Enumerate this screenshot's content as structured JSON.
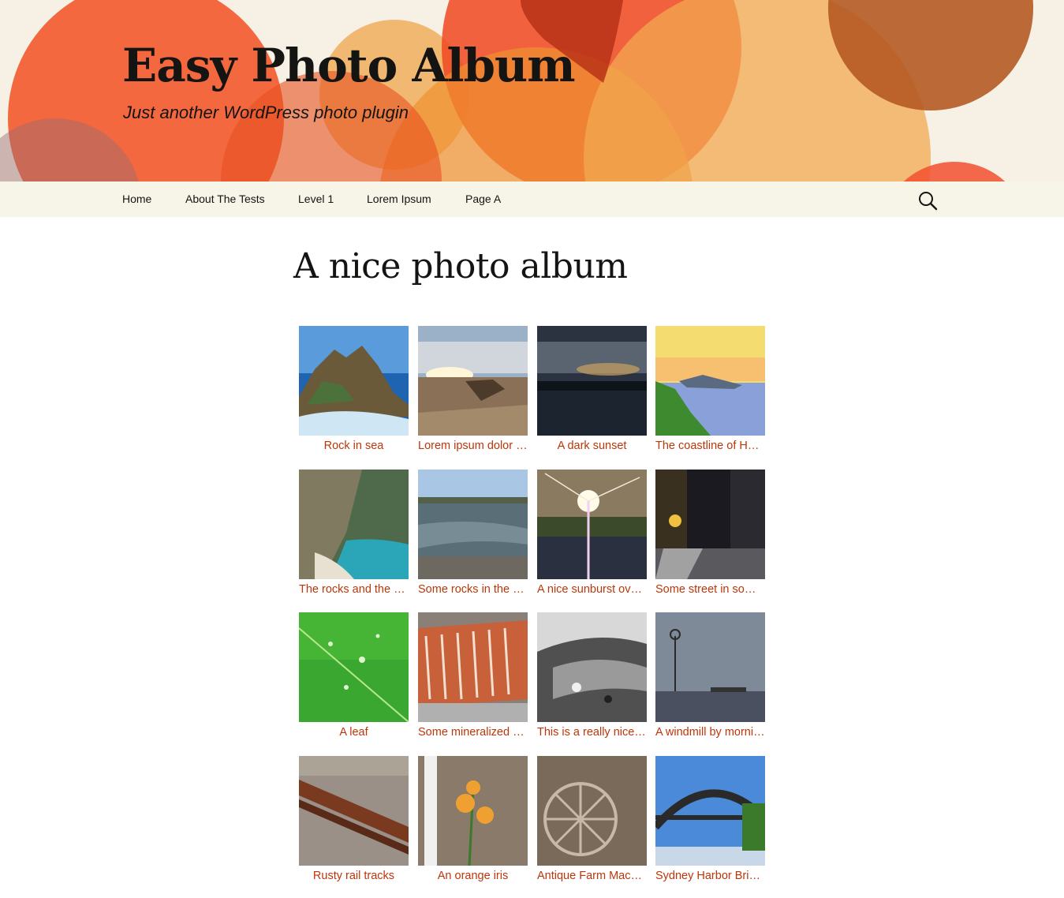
{
  "site": {
    "title": "Easy Photo Album",
    "description": "Just another WordPress photo plugin"
  },
  "nav": {
    "items": [
      "Home",
      "About The Tests",
      "Level 1",
      "Lorem Ipsum",
      "Page A"
    ],
    "search_icon": "search-icon"
  },
  "page": {
    "title": "A nice photo album"
  },
  "colors": {
    "link": "#bc360a",
    "header_bg": "#f6f1e4",
    "nav_bg": "#f7f5e7"
  },
  "gallery": {
    "photos": [
      {
        "caption": "Rock in sea"
      },
      {
        "caption": "Lorem ipsum dolor sit amet"
      },
      {
        "caption": "A dark sunset"
      },
      {
        "caption": "The coastline of Hawaii"
      },
      {
        "caption": "The rocks and the sea"
      },
      {
        "caption": "Some rocks in the sea"
      },
      {
        "caption": "A nice sunburst over the water"
      },
      {
        "caption": "Some street in some city"
      },
      {
        "caption": "A leaf"
      },
      {
        "caption": "Some mineralized wood"
      },
      {
        "caption": "This is a really nice photo"
      },
      {
        "caption": "A windmill by morning"
      },
      {
        "caption": "Rusty rail tracks"
      },
      {
        "caption": "An orange iris"
      },
      {
        "caption": "Antique Farm Machinery"
      },
      {
        "caption": "Sydney Harbor Bridge"
      }
    ]
  }
}
